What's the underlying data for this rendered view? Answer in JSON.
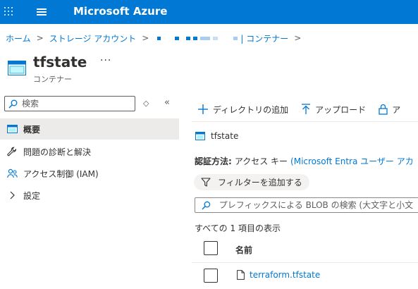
{
  "topbar": {
    "brand": "Microsoft Azure",
    "color": "#0078d4"
  },
  "icons": {
    "menu": "waffle-icon",
    "nav": "hamburger-icon",
    "container": "container-icon",
    "search": "search-icon",
    "filter": "filter-icon",
    "file": "file-icon"
  },
  "breadcrumb": {
    "home": "ホーム",
    "storage_accounts": "ストレージ アカウント",
    "containers": "| コンテナー",
    "separator": ">"
  },
  "header": {
    "title": "tfstate",
    "subtitle": "コンテナー",
    "more": "···"
  },
  "sidebar": {
    "search_placeholder": "検索",
    "items": [
      {
        "label": "概要",
        "active": true,
        "icon": "container-icon"
      },
      {
        "label": "問題の診断と解決",
        "active": false,
        "icon": "wrench-icon"
      },
      {
        "label": "アクセス制御 (IAM)",
        "active": false,
        "icon": "people-icon"
      },
      {
        "label": "設定",
        "active": false,
        "icon": "chevron-right-icon"
      }
    ]
  },
  "toolbar": {
    "add_directory": "ディレクトリの追加",
    "upload": "アップロード",
    "lock": "ア"
  },
  "main": {
    "container_name": "tfstate",
    "auth_label": "認証方法:",
    "auth_value": "アクセス キー",
    "auth_link": "(Microsoft Entra ユーザー アカ",
    "filter_label": "フィルターを追加する",
    "prefix_placeholder": "プレフィックスによる BLOB の検索 (大文字と小文",
    "showing": "すべての 1 項目の表示",
    "column_name": "名前",
    "files": [
      {
        "name": "terraform.tfstate"
      }
    ]
  }
}
